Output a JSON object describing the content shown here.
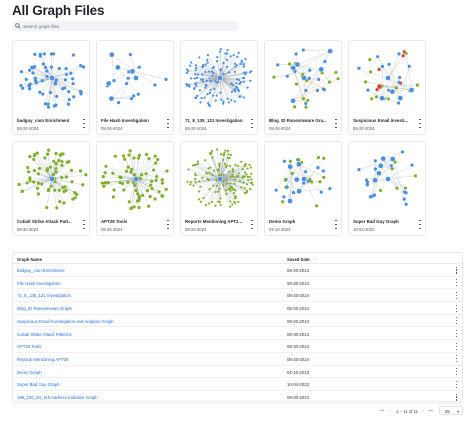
{
  "page": {
    "title": "All Graph Files"
  },
  "search": {
    "placeholder": "Search graph files"
  },
  "cards": [
    {
      "name": "badguy_com Enrichment",
      "date": "08-20-2024",
      "style": "star"
    },
    {
      "name": "File Hash Investigation",
      "date": "08-20-2024",
      "style": "sparse"
    },
    {
      "name": "71_8_135_131 Investigation",
      "date": "08-20-2024",
      "style": "dense"
    },
    {
      "name": "Blog_ID Ransomware Gra...",
      "date": "08-20-2024",
      "style": "web"
    },
    {
      "name": "Suspicious Email Investi...",
      "date": "08-20-2024",
      "style": "web2"
    },
    {
      "name": "Cobalt Strike Attack Patt...",
      "date": "08-30-2024",
      "style": "green"
    },
    {
      "name": "APT28 Tools",
      "date": "08-30-2024",
      "style": "green2"
    },
    {
      "name": "Reports Mentioning APT2...",
      "date": "08-20-2024",
      "style": "greendense"
    },
    {
      "name": "Demo Graph",
      "date": "02-10-2023",
      "style": "mixed"
    },
    {
      "name": "Super Bad Guy Graph",
      "date": "10-04-2022",
      "style": "tree"
    }
  ],
  "table": {
    "col_name": "Graph Name",
    "col_date": "Saved Date",
    "sort_icon": "↓",
    "rows": [
      {
        "name": "badguy_com Enrichment",
        "date": "08-20-2024"
      },
      {
        "name": "File Hash Investigation",
        "date": "08-20-2024"
      },
      {
        "name": "71_8_135_131 Investigation",
        "date": "08-20-2024"
      },
      {
        "name": "Blog_ID Ransomware Graph",
        "date": "08-20-2024"
      },
      {
        "name": "Suspicious Email Investigation and Analysis Graph",
        "date": "08-20-2024"
      },
      {
        "name": "Cobalt Strike Attack Patterns",
        "date": "08-30-2024"
      },
      {
        "name": "APT28 Tools",
        "date": "08-30-2024"
      },
      {
        "name": "Reports Mentioning APT29",
        "date": "08-20-2024"
      },
      {
        "name": "Demo Graph",
        "date": "02-10-2023"
      },
      {
        "name": "Super Bad Guy Graph",
        "date": "10-04-2022"
      },
      {
        "name": "185_220_93_115 Address Indicator Graph",
        "date": "08-20-2024"
      }
    ]
  },
  "pagination": {
    "range": "1 – 11 of 11",
    "per_page": "25",
    "first_icon": "⏮",
    "prev_icon": "‹",
    "next_icon": "›",
    "last_icon": "⏭",
    "dropdown_icon": "▾"
  },
  "colors": {
    "link": "#1e6fe0",
    "node_blue": "#4a8fe0",
    "node_green": "#7fb02a",
    "node_red": "#d9432c",
    "edge": "#9aa4ae"
  }
}
